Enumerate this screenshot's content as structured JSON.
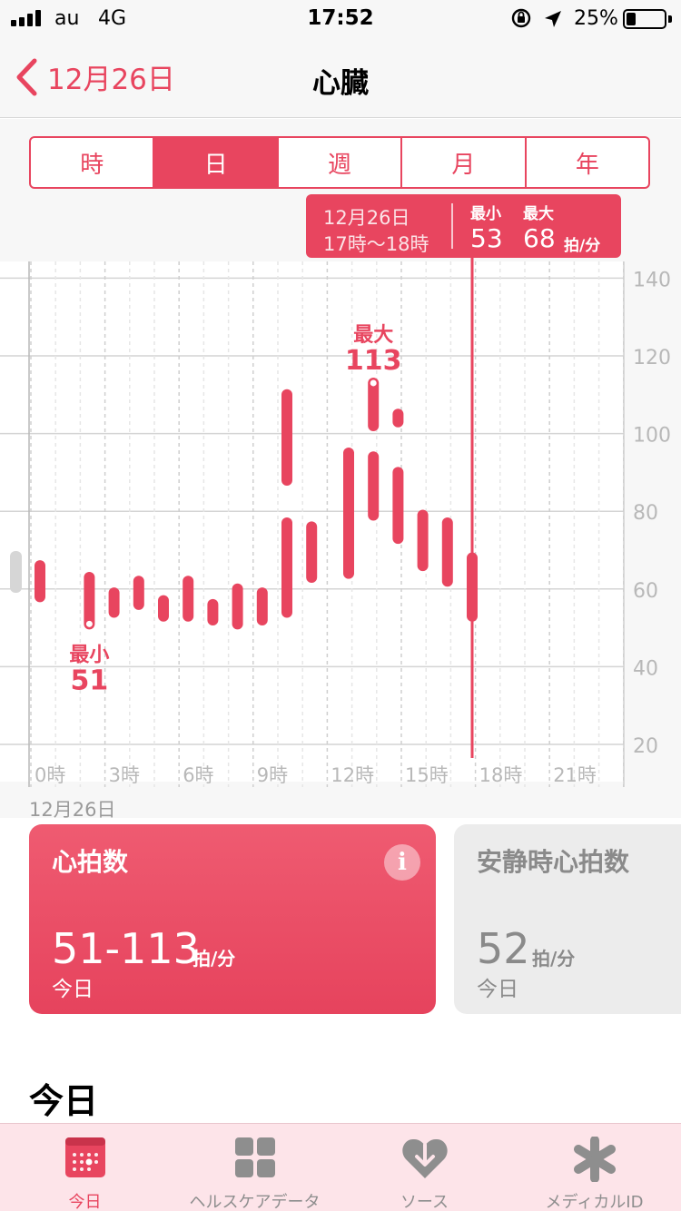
{
  "status_bar": {
    "carrier": "au",
    "network": "4G",
    "time": "17:52",
    "battery_percent_text": "25%",
    "battery_level": 0.25
  },
  "navbar": {
    "back_label": "12月26日",
    "title": "心臓"
  },
  "segments": [
    {
      "label": "時",
      "active": false
    },
    {
      "label": "日",
      "active": true
    },
    {
      "label": "週",
      "active": false
    },
    {
      "label": "月",
      "active": false
    },
    {
      "label": "年",
      "active": false
    }
  ],
  "callout": {
    "date": "12月26日",
    "hours": "17時〜18時",
    "min_label": "最小",
    "max_label": "最大",
    "min_value": "53",
    "max_value": "68",
    "unit": "拍/分"
  },
  "chart_data": {
    "type": "range_bar",
    "y_ticks": [
      "140",
      "120",
      "100",
      "80",
      "60",
      "40",
      "20"
    ],
    "ylim": [
      20,
      140
    ],
    "x_tick_labels": [
      "0時",
      "3時",
      "6時",
      "9時",
      "12時",
      "15時",
      "18時",
      "21時"
    ],
    "x_tick_hours": [
      0,
      3,
      6,
      9,
      12,
      15,
      18,
      21
    ],
    "bars": [
      {
        "hour": 0.0,
        "min": 58,
        "max": 66
      },
      {
        "hour": 2.0,
        "min": 51,
        "max": 63
      },
      {
        "hour": 3.0,
        "min": 54,
        "max": 59
      },
      {
        "hour": 4.0,
        "min": 56,
        "max": 62
      },
      {
        "hour": 5.0,
        "min": 53,
        "max": 57
      },
      {
        "hour": 6.0,
        "min": 53,
        "max": 62
      },
      {
        "hour": 7.0,
        "min": 52,
        "max": 56
      },
      {
        "hour": 8.0,
        "min": 51,
        "max": 60
      },
      {
        "hour": 9.0,
        "min": 52,
        "max": 59
      },
      {
        "hour": 10.0,
        "min": 54,
        "max": 77
      },
      {
        "hour": 10.0,
        "min": 88,
        "max": 110
      },
      {
        "hour": 11.0,
        "min": 63,
        "max": 76
      },
      {
        "hour": 12.5,
        "min": 64,
        "max": 95
      },
      {
        "hour": 13.5,
        "min": 79,
        "max": 94
      },
      {
        "hour": 13.5,
        "min": 102,
        "max": 113
      },
      {
        "hour": 14.5,
        "min": 73,
        "max": 90
      },
      {
        "hour": 14.5,
        "min": 103,
        "max": 105
      },
      {
        "hour": 15.5,
        "min": 66,
        "max": 79
      },
      {
        "hour": 16.5,
        "min": 62,
        "max": 77
      },
      {
        "hour": 17.5,
        "min": 53,
        "max": 68
      }
    ],
    "selected_hour": 17.5,
    "min_annotation": {
      "label": "最小",
      "value": "51",
      "hour": 2.0
    },
    "max_annotation": {
      "label": "最大",
      "value": "113",
      "hour": 13.5
    },
    "accent_color": "#e8455f",
    "grid": true
  },
  "chart_date_label": "12月26日",
  "cards": {
    "heart_rate": {
      "title": "心拍数",
      "value": "51-113",
      "unit": "拍/分",
      "sub": "今日"
    },
    "resting": {
      "title": "安静時心拍数",
      "value": "52",
      "unit": "拍/分",
      "sub": "今日"
    }
  },
  "section_heading": "今日",
  "tabbar": [
    {
      "label": "今日",
      "icon": "calendar-icon",
      "active": true
    },
    {
      "label": "ヘルスケアデータ",
      "icon": "grid-icon",
      "active": false
    },
    {
      "label": "ソース",
      "icon": "heart-download-icon",
      "active": false
    },
    {
      "label": "メディカルID",
      "icon": "asterisk-icon",
      "active": false
    }
  ],
  "colors": {
    "accent": "#e8455f",
    "tab_bg": "#fde4e9"
  }
}
